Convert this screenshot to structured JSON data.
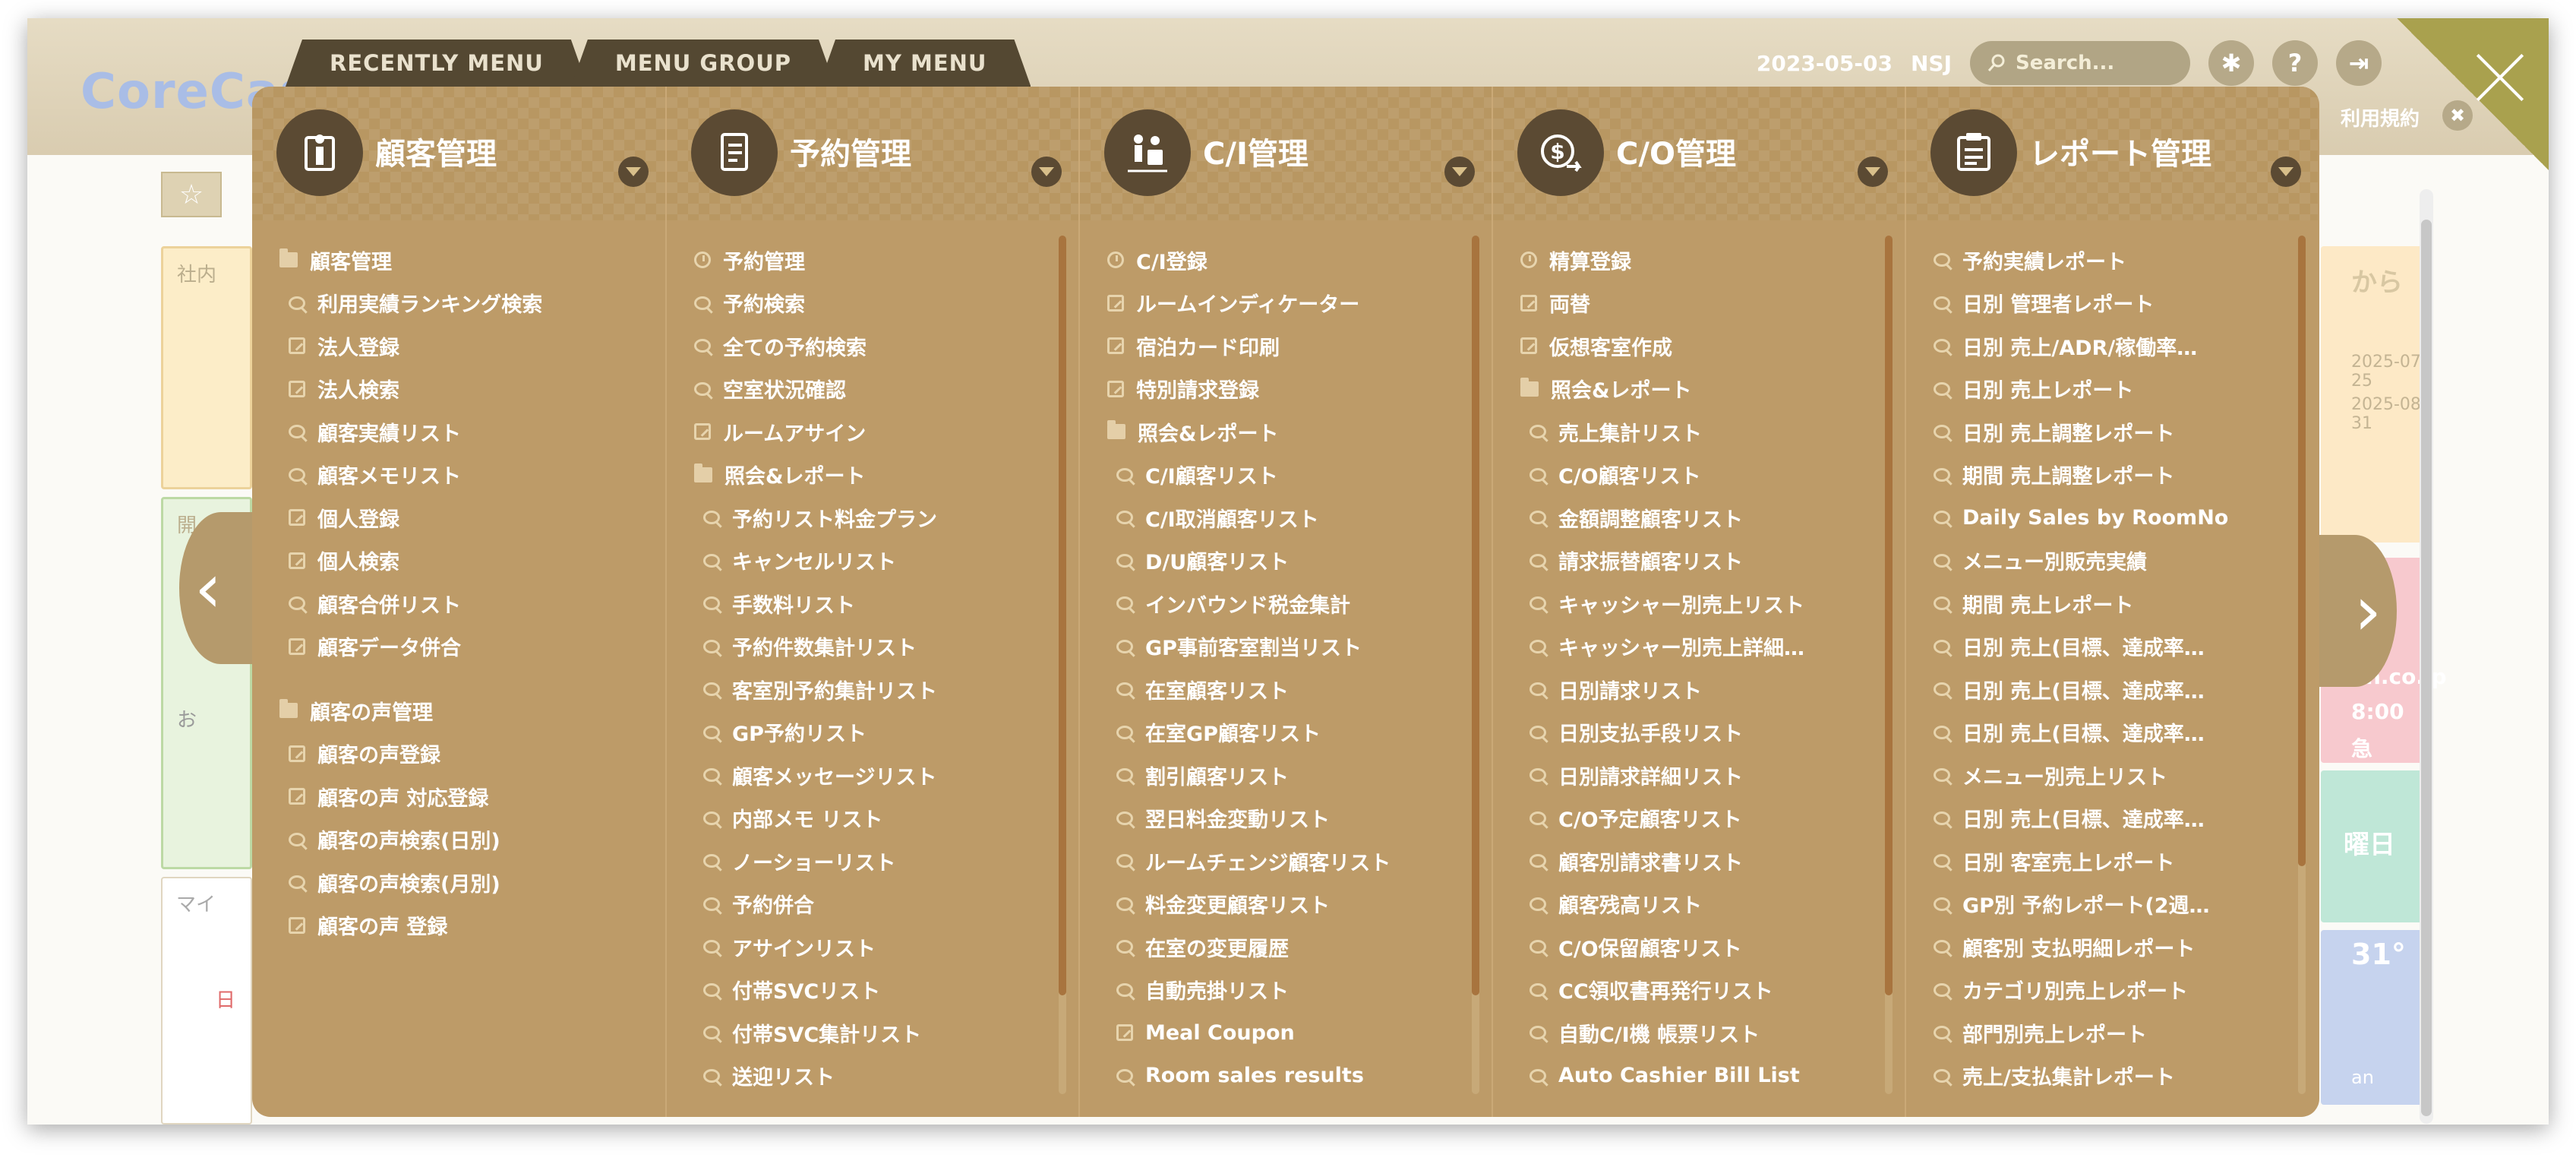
{
  "header": {
    "logo": "CoreCast",
    "date": "2023-05-03",
    "user": "NSJ",
    "search_placeholder": "Search...",
    "terms": "利用規約"
  },
  "background": {
    "fragments": [
      "社内",
      "開",
      "お",
      "マイ",
      "日",
      "から",
      "2025-07-25",
      "2025-08-31",
      "an.co.jp",
      "8:00",
      "急",
      "曜日",
      "31°",
      "an"
    ]
  },
  "tabs": [
    {
      "label": "RECENTLY MENU"
    },
    {
      "label": "MENU GROUP"
    },
    {
      "label": "MY MENU"
    }
  ],
  "columns": [
    {
      "title": "顧客管理",
      "icon": "customer-icon",
      "items": [
        {
          "label": "顧客管理",
          "icon": "folder",
          "level": 0
        },
        {
          "label": "利用実績ランキング検索",
          "icon": "search",
          "level": 1
        },
        {
          "label": "法人登録",
          "icon": "edit",
          "level": 1
        },
        {
          "label": "法人検索",
          "icon": "edit",
          "level": 1
        },
        {
          "label": "顧客実績リスト",
          "icon": "search",
          "level": 1
        },
        {
          "label": "顧客メモリスト",
          "icon": "search",
          "level": 1
        },
        {
          "label": "個人登録",
          "icon": "edit",
          "level": 1
        },
        {
          "label": "個人検索",
          "icon": "edit",
          "level": 1
        },
        {
          "label": "顧客合併リスト",
          "icon": "search",
          "level": 1
        },
        {
          "label": "顧客データ併合",
          "icon": "edit",
          "level": 1
        },
        {
          "label": "顧客の声管理",
          "icon": "folder",
          "level": 0,
          "gap": true
        },
        {
          "label": "顧客の声登録",
          "icon": "edit",
          "level": 1
        },
        {
          "label": "顧客の声 対応登録",
          "icon": "edit",
          "level": 1
        },
        {
          "label": "顧客の声検索(日別)",
          "icon": "search",
          "level": 1
        },
        {
          "label": "顧客の声検索(月別)",
          "icon": "search",
          "level": 1
        },
        {
          "label": "顧客の声 登録",
          "icon": "edit",
          "level": 1
        }
      ]
    },
    {
      "title": "予約管理",
      "icon": "reservation-icon",
      "items": [
        {
          "label": "予約管理",
          "icon": "clock",
          "level": 0
        },
        {
          "label": "予約検索",
          "icon": "search",
          "level": 0
        },
        {
          "label": "全ての予約検索",
          "icon": "search",
          "level": 0
        },
        {
          "label": "空室状況確認",
          "icon": "search",
          "level": 0
        },
        {
          "label": "ルームアサイン",
          "icon": "edit",
          "level": 0
        },
        {
          "label": "照会&レポート",
          "icon": "folder",
          "level": 0
        },
        {
          "label": "予約リスト料金プラン",
          "icon": "search",
          "level": 1
        },
        {
          "label": "キャンセルリスト",
          "icon": "search",
          "level": 1
        },
        {
          "label": "手数料リスト",
          "icon": "search",
          "level": 1
        },
        {
          "label": "予約件数集計リスト",
          "icon": "search",
          "level": 1
        },
        {
          "label": "客室別予約集計リスト",
          "icon": "search",
          "level": 1
        },
        {
          "label": "GP予約リスト",
          "icon": "search",
          "level": 1
        },
        {
          "label": "顧客メッセージリスト",
          "icon": "search",
          "level": 1
        },
        {
          "label": "内部メモ リスト",
          "icon": "search",
          "level": 1
        },
        {
          "label": "ノーショーリスト",
          "icon": "search",
          "level": 1
        },
        {
          "label": "予約併合",
          "icon": "search",
          "level": 1
        },
        {
          "label": "アサインリスト",
          "icon": "search",
          "level": 1
        },
        {
          "label": "付帯SVCリスト",
          "icon": "search",
          "level": 1
        },
        {
          "label": "付帯SVC集計リスト",
          "icon": "search",
          "level": 1
        },
        {
          "label": "送迎リスト",
          "icon": "search",
          "level": 1
        }
      ]
    },
    {
      "title": "C/I管理",
      "icon": "checkin-icon",
      "items": [
        {
          "label": "C/I登録",
          "icon": "clock",
          "level": 0
        },
        {
          "label": "ルームインディケーター",
          "icon": "edit",
          "level": 0
        },
        {
          "label": "宿泊カード印刷",
          "icon": "edit",
          "level": 0
        },
        {
          "label": "特別請求登録",
          "icon": "edit",
          "level": 0
        },
        {
          "label": "照会&レポート",
          "icon": "folder",
          "level": 0
        },
        {
          "label": "C/I顧客リスト",
          "icon": "search",
          "level": 1
        },
        {
          "label": "C/I取消顧客リスト",
          "icon": "search",
          "level": 1
        },
        {
          "label": "D/U顧客リスト",
          "icon": "search",
          "level": 1
        },
        {
          "label": "インバウンド税金集計",
          "icon": "search",
          "level": 1
        },
        {
          "label": "GP事前客室割当リスト",
          "icon": "search",
          "level": 1
        },
        {
          "label": "在室顧客リスト",
          "icon": "search",
          "level": 1
        },
        {
          "label": "在室GP顧客リスト",
          "icon": "search",
          "level": 1
        },
        {
          "label": "割引顧客リスト",
          "icon": "search",
          "level": 1
        },
        {
          "label": "翌日料金変動リスト",
          "icon": "search",
          "level": 1
        },
        {
          "label": "ルームチェンジ顧客リスト",
          "icon": "search",
          "level": 1
        },
        {
          "label": "料金変更顧客リスト",
          "icon": "search",
          "level": 1
        },
        {
          "label": "在室の変更履歴",
          "icon": "search",
          "level": 1
        },
        {
          "label": "自動売掛リスト",
          "icon": "search",
          "level": 1
        },
        {
          "label": "Meal Coupon",
          "icon": "edit",
          "level": 1
        },
        {
          "label": "Room sales results",
          "icon": "search",
          "level": 1
        }
      ]
    },
    {
      "title": "C/O管理",
      "icon": "checkout-icon",
      "items": [
        {
          "label": "精算登録",
          "icon": "clock",
          "level": 0
        },
        {
          "label": "両替",
          "icon": "edit",
          "level": 0
        },
        {
          "label": "仮想客室作成",
          "icon": "edit",
          "level": 0
        },
        {
          "label": "照会&レポート",
          "icon": "folder",
          "level": 0
        },
        {
          "label": "売上集計リスト",
          "icon": "search",
          "level": 1
        },
        {
          "label": "C/O顧客リスト",
          "icon": "search",
          "level": 1
        },
        {
          "label": "金額調整顧客リスト",
          "icon": "search",
          "level": 1
        },
        {
          "label": "請求振替顧客リスト",
          "icon": "search",
          "level": 1
        },
        {
          "label": "キャッシャー別売上リスト",
          "icon": "search",
          "level": 1
        },
        {
          "label": "キャッシャー別売上詳細…",
          "icon": "search",
          "level": 1
        },
        {
          "label": "日別請求リスト",
          "icon": "search",
          "level": 1
        },
        {
          "label": "日別支払手段リスト",
          "icon": "search",
          "level": 1
        },
        {
          "label": "日別請求詳細リスト",
          "icon": "search",
          "level": 1
        },
        {
          "label": "C/O予定顧客リスト",
          "icon": "search",
          "level": 1
        },
        {
          "label": "顧客別請求書リスト",
          "icon": "search",
          "level": 1
        },
        {
          "label": "顧客残高リスト",
          "icon": "search",
          "level": 1
        },
        {
          "label": "C/O保留顧客リスト",
          "icon": "search",
          "level": 1
        },
        {
          "label": "CC領収書再発行リスト",
          "icon": "search",
          "level": 1
        },
        {
          "label": "自動C/I機 帳票リスト",
          "icon": "search",
          "level": 1
        },
        {
          "label": "Auto Cashier Bill List",
          "icon": "search",
          "level": 1
        }
      ]
    },
    {
      "title": "レポート管理",
      "icon": "report-icon",
      "items": [
        {
          "label": "予約実績レポート",
          "icon": "search",
          "level": 0
        },
        {
          "label": "日別 管理者レポート",
          "icon": "search",
          "level": 0
        },
        {
          "label": "日別 売上/ADR/稼働率…",
          "icon": "search",
          "level": 0
        },
        {
          "label": "日別 売上レポート",
          "icon": "search",
          "level": 0
        },
        {
          "label": "日別 売上調整レポート",
          "icon": "search",
          "level": 0
        },
        {
          "label": "期間 売上調整レポート",
          "icon": "search",
          "level": 0
        },
        {
          "label": "Daily Sales by RoomNo",
          "icon": "search",
          "level": 0
        },
        {
          "label": "メニュー別販売実績",
          "icon": "search",
          "level": 0
        },
        {
          "label": "期間 売上レポート",
          "icon": "search",
          "level": 0
        },
        {
          "label": "日別 売上(目標、達成率…",
          "icon": "search",
          "level": 0
        },
        {
          "label": "日別 売上(目標、達成率…",
          "icon": "search",
          "level": 0
        },
        {
          "label": "日別 売上(目標、達成率…",
          "icon": "search",
          "level": 0
        },
        {
          "label": "メニュー別売上リスト",
          "icon": "search",
          "level": 0
        },
        {
          "label": "日別 売上(目標、達成率…",
          "icon": "search",
          "level": 0
        },
        {
          "label": "日別 客室売上レポート",
          "icon": "search",
          "level": 0
        },
        {
          "label": "GP別 予約レポート(2週…",
          "icon": "search",
          "level": 0
        },
        {
          "label": "顧客別 支払明細レポート",
          "icon": "search",
          "level": 0
        },
        {
          "label": "カテゴリ別売上レポート",
          "icon": "search",
          "level": 0
        },
        {
          "label": "部門別売上レポート",
          "icon": "search",
          "level": 0
        },
        {
          "label": "売上/支払集計レポート",
          "icon": "search",
          "level": 0
        }
      ]
    }
  ],
  "colors": {
    "menu_bg": "#bd9b68",
    "tab_bg": "#544832",
    "icon_bg": "#5b4a33",
    "close_corner": "#a9a14e",
    "scroll_thumb": "#a8743e"
  }
}
